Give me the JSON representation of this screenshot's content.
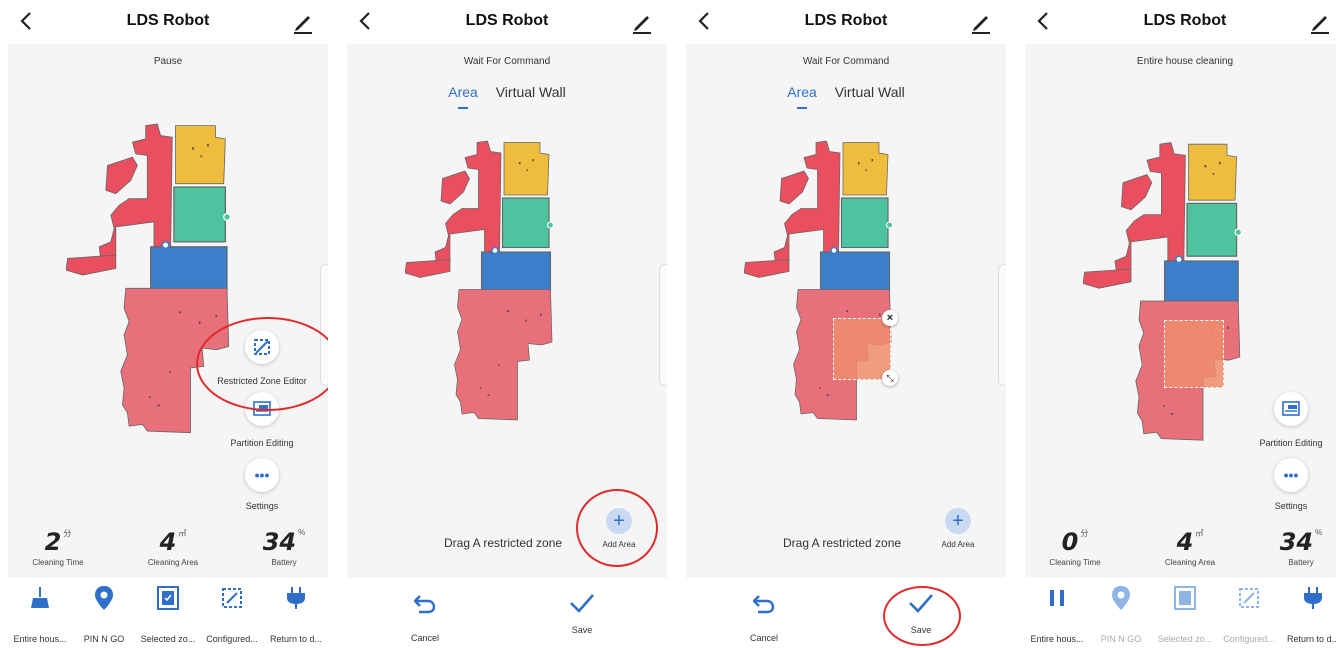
{
  "header": {
    "title": "LDS Robot"
  },
  "panels": [
    {
      "status": "Pause",
      "fab_restricted": "Restricted Zone Editor",
      "fab_partition": "Partition Editing",
      "fab_settings": "Settings",
      "stats": [
        {
          "value": "2",
          "unit": "分",
          "label": "Cleaning Time"
        },
        {
          "value": "4",
          "unit": "㎡",
          "label": "Cleaning Area"
        },
        {
          "value": "34",
          "unit": "%",
          "label": "Battery"
        }
      ],
      "bottom": [
        "Entire hous...",
        "PIN N GO",
        "Selected zo...",
        "Configured...",
        "Return to d..."
      ]
    },
    {
      "status": "Wait For Command",
      "tabs": [
        "Area",
        "Virtual Wall"
      ],
      "drag": "Drag A restricted zone",
      "add": "Add Area",
      "cancel": "Cancel",
      "save": "Save"
    },
    {
      "status": "Wait For Command",
      "tabs": [
        "Area",
        "Virtual Wall"
      ],
      "drag": "Drag A restricted zone",
      "add": "Add Area",
      "cancel": "Cancel",
      "save": "Save"
    },
    {
      "status": "Entire house cleaning",
      "fab_partition": "Partition Editing",
      "fab_settings": "Settings",
      "stats": [
        {
          "value": "0",
          "unit": "分",
          "label": "Cleaning Time"
        },
        {
          "value": "4",
          "unit": "㎡",
          "label": "Cleaning Area"
        },
        {
          "value": "34",
          "unit": "%",
          "label": "Battery"
        }
      ],
      "bottom": [
        "Entire hous...",
        "PIN N GO",
        "Selected zo...",
        "Configured...",
        "Return to d..."
      ]
    }
  ],
  "colors": {
    "accent": "#2f6fc9",
    "highlight_ring": "#e02a2a",
    "room_red": "#e94f5e",
    "room_yellow": "#eebd3d",
    "room_green": "#4dc3a0",
    "room_blue": "#3b7fcb",
    "room_pink": "#e8707a",
    "restricted_zone": "#ef8c6c"
  },
  "icons": {
    "back": "back-arrow-icon",
    "edit": "pencil-icon",
    "broom": "broom-icon",
    "pin": "location-pin-icon",
    "selected": "selected-zone-icon",
    "configured": "configured-zone-icon",
    "return": "plug-icon",
    "pause": "pause-icon",
    "undo": "undo-icon",
    "check": "check-icon",
    "plus": "plus-icon",
    "close": "close-icon",
    "resize": "resize-icon",
    "settings": "more-dots-icon",
    "partition": "partition-icon",
    "restricted": "restricted-zone-icon"
  }
}
